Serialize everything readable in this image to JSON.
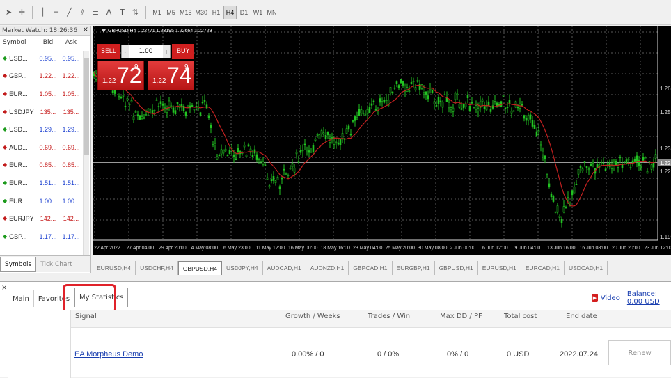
{
  "toolbar": {
    "timeframes": [
      {
        "label": "M1",
        "active": false
      },
      {
        "label": "M5",
        "active": false
      },
      {
        "label": "M15",
        "active": false
      },
      {
        "label": "M30",
        "active": false
      },
      {
        "label": "H1",
        "active": false
      },
      {
        "label": "H4",
        "active": true
      },
      {
        "label": "D1",
        "active": false
      },
      {
        "label": "W1",
        "active": false
      },
      {
        "label": "MN",
        "active": false
      }
    ]
  },
  "market_watch": {
    "title": "Market Watch: 18:26:36",
    "close_glyph": "×",
    "columns": {
      "symbol": "Symbol",
      "bid": "Bid",
      "ask": "Ask"
    },
    "rows": [
      {
        "symbol": "USD...",
        "bid": "0.95...",
        "ask": "0.95...",
        "dir": "up"
      },
      {
        "symbol": "GBP...",
        "bid": "1.22...",
        "ask": "1.22...",
        "dir": "down"
      },
      {
        "symbol": "EUR...",
        "bid": "1.05...",
        "ask": "1.05...",
        "dir": "down"
      },
      {
        "symbol": "USDJPY",
        "bid": "135...",
        "ask": "135...",
        "dir": "down"
      },
      {
        "symbol": "USD...",
        "bid": "1.29...",
        "ask": "1.29...",
        "dir": "up"
      },
      {
        "symbol": "AUD...",
        "bid": "0.69...",
        "ask": "0.69...",
        "dir": "down"
      },
      {
        "symbol": "EUR...",
        "bid": "0.85...",
        "ask": "0.85...",
        "dir": "down"
      },
      {
        "symbol": "EUR...",
        "bid": "1.51...",
        "ask": "1.51...",
        "dir": "up"
      },
      {
        "symbol": "EUR...",
        "bid": "1.00...",
        "ask": "1.00...",
        "dir": "up"
      },
      {
        "symbol": "EURJPY",
        "bid": "142...",
        "ask": "142...",
        "dir": "down"
      },
      {
        "symbol": "GBP...",
        "bid": "1.17...",
        "ask": "1.17...",
        "dir": "up"
      }
    ],
    "tabs": {
      "symbols": "Symbols",
      "tick_chart": "Tick Chart"
    }
  },
  "chart": {
    "info": "GBPUSD,H4  1.22771  1.23195  1.22664  1.22729",
    "sell_label": "SELL",
    "buy_label": "BUY",
    "lot_value": "1.00",
    "lot_minus": "-",
    "lot_plus": "+",
    "sell_price": {
      "prefix": "1.22",
      "big": "72",
      "sup": "9"
    },
    "buy_price": {
      "prefix": "1.22",
      "big": "74",
      "sup": "9"
    },
    "y_labels": [
      "1.26",
      "1.25",
      "1.23",
      "1.22",
      "1.19"
    ],
    "current_price_label": "1.22",
    "x_labels": [
      "22 Apr 2022",
      "27 Apr 04:00",
      "29 Apr 20:00",
      "4 May 08:00",
      "6 May 23:00",
      "11 May 12:00",
      "16 May 00:00",
      "18 May 16:00",
      "23 May 04:00",
      "25 May 20:00",
      "30 May 08:00",
      "2 Jun 00:00",
      "6 Jun 12:00",
      "9 Jun 04:00",
      "13 Jun 16:00",
      "16 Jun 08:00",
      "20 Jun 20:00",
      "23 Jun 12:00"
    ],
    "colors": {
      "candle": "#22c322",
      "ma": "#c42020",
      "grid": "#5a5a5a",
      "background": "#000000"
    }
  },
  "chart_tabs": [
    {
      "label": "EURUSD,H4",
      "active": false
    },
    {
      "label": "USDCHF,H4",
      "active": false
    },
    {
      "label": "GBPUSD,H4",
      "active": true
    },
    {
      "label": "USDJPY,H4",
      "active": false
    },
    {
      "label": "AUDCAD,H1",
      "active": false
    },
    {
      "label": "AUDNZD,H1",
      "active": false
    },
    {
      "label": "GBPCAD,H1",
      "active": false
    },
    {
      "label": "EURGBP,H1",
      "active": false
    },
    {
      "label": "GBPUSD,H1",
      "active": false
    },
    {
      "label": "EURUSD,H1",
      "active": false
    },
    {
      "label": "EURCAD,H1",
      "active": false
    },
    {
      "label": "USDCAD,H1",
      "active": false
    }
  ],
  "terminal": {
    "close_glyph": "×",
    "tabs": [
      {
        "label": "Main",
        "active": false
      },
      {
        "label": "Favorites",
        "active": false
      },
      {
        "label": "My Statistics",
        "active": true
      }
    ],
    "video_label": "Video",
    "balance_label": "Balance: 0.00 USD",
    "headers": {
      "signal": "Signal",
      "growth": "Growth / Weeks",
      "trades": "Trades / Win",
      "maxdd": "Max DD / PF",
      "cost": "Total cost",
      "end": "End date"
    },
    "row": {
      "signal": "EA Morpheus Demo",
      "growth": "0.00% / 0",
      "trades": "0 / 0%",
      "maxdd": "0% / 0",
      "cost": "0 USD",
      "end": "2022.07.24",
      "action": "Renew"
    }
  }
}
